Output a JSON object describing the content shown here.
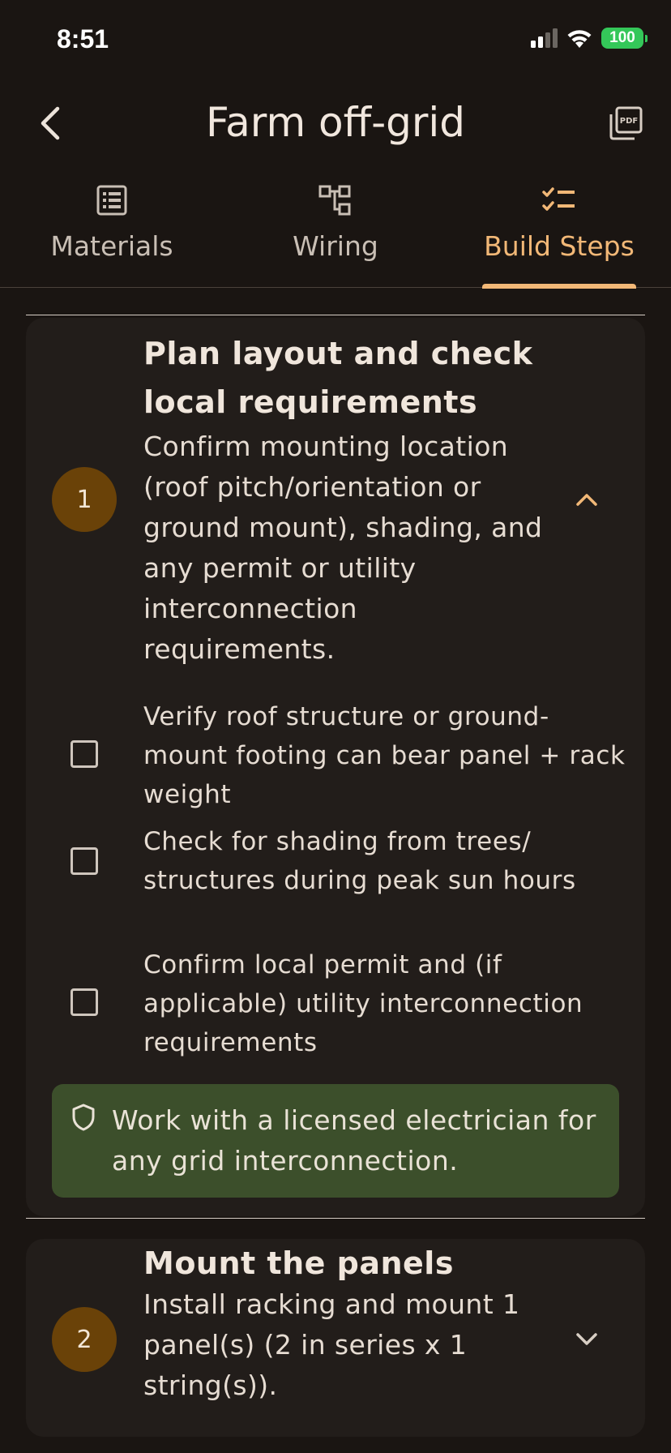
{
  "status_bar": {
    "time": "8:51",
    "battery": "100"
  },
  "header": {
    "title": "Farm off-grid",
    "back_icon": "chevron-left-icon",
    "pdf_icon": "pdf-export-icon"
  },
  "tabs": [
    {
      "label": "Materials",
      "icon": "list-icon",
      "active": false
    },
    {
      "label": "Wiring",
      "icon": "wiring-diagram-icon",
      "active": false
    },
    {
      "label": "Build Steps",
      "icon": "checklist-icon",
      "active": true
    }
  ],
  "steps": [
    {
      "number": "1",
      "title_line1": "Plan layout and check",
      "title_line2": "local requirements",
      "description": "Confirm mounting location (roof pitch/orientation or ground mount), shading, and any permit or utility interconnection requirements.",
      "expanded": true,
      "checklist": [
        {
          "label": "Verify roof structure or ground-mount footing can bear panel + rack weight",
          "checked": false
        },
        {
          "label": "Check for shading from trees/ structures during peak sun hours",
          "checked": false
        },
        {
          "label": "Confirm local permit and (if applicable) utility interconnection requirements",
          "checked": false
        }
      ],
      "safety_note": "Work with a licensed electrician for any grid interconnection."
    },
    {
      "number": "2",
      "title": "Mount the panels",
      "description": "Install racking and mount 1 panel(s) (2 in series x 1 string(s)).",
      "expanded": false
    }
  ],
  "colors": {
    "accent": "#f2b877",
    "step_badge": "#6a4208",
    "safety_bg": "#3c4f2b",
    "background": "#1a1512",
    "card": "#221d1a"
  }
}
